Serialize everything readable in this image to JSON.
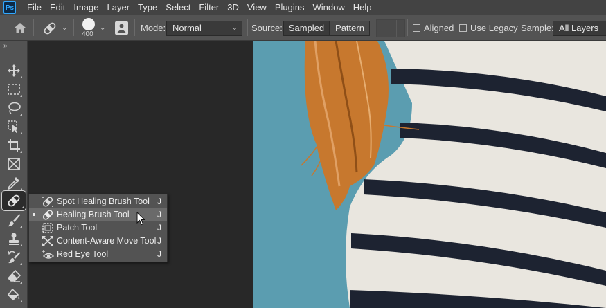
{
  "app": {
    "logo": "Ps"
  },
  "menu": [
    "File",
    "Edit",
    "Image",
    "Layer",
    "Type",
    "Select",
    "Filter",
    "3D",
    "View",
    "Plugins",
    "Window",
    "Help"
  ],
  "options": {
    "brush_size": "400",
    "mode_label": "Mode:",
    "mode_value": "Normal",
    "source_label": "Source:",
    "source_options": [
      "Sampled",
      "Pattern"
    ],
    "source_selected": "Sampled",
    "aligned_label": "Aligned",
    "aligned_checked": false,
    "use_legacy_label": "Use Legacy",
    "use_legacy_checked": false,
    "sample_label": "Sample:",
    "sample_value": "All Layers"
  },
  "toolbar": {
    "collapse_glyph": "»",
    "tools": [
      "move-tool",
      "rectangular-marquee-tool",
      "lasso-tool",
      "object-selection-tool",
      "crop-tool",
      "frame-tool",
      "eyedropper-tool",
      "healing-brush-tool",
      "brush-tool",
      "clone-stamp-tool",
      "history-brush-tool",
      "eraser-tool",
      "paint-bucket-tool"
    ],
    "active_tool": "healing-brush-tool"
  },
  "flyout": {
    "items": [
      {
        "label": "Spot Healing Brush Tool",
        "shortcut": "J",
        "icon": "spot-healing-brush-icon"
      },
      {
        "label": "Healing Brush Tool",
        "shortcut": "J",
        "icon": "healing-brush-icon"
      },
      {
        "label": "Patch Tool",
        "shortcut": "J",
        "icon": "patch-icon"
      },
      {
        "label": "Content-Aware Move Tool",
        "shortcut": "J",
        "icon": "content-aware-move-icon"
      },
      {
        "label": "Red Eye Tool",
        "shortcut": "J",
        "icon": "red-eye-icon"
      }
    ],
    "selected_index": 1,
    "hover_index": 1
  },
  "colors": {
    "menubar_bg": "#434343",
    "panel_bg": "#535353",
    "workspace_bg": "#282828",
    "photo_background": "#5b9db0",
    "hair": "#c7782e",
    "shirt": "#e9e6df",
    "stripes": "#1d2331"
  }
}
